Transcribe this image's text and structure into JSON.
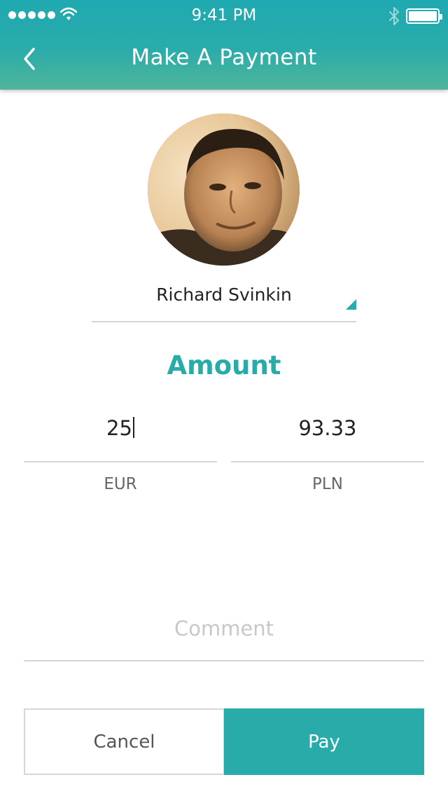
{
  "status_bar": {
    "time": "9:41 PM",
    "signal_bars": 5,
    "icons": [
      "signal-dots",
      "wifi-icon",
      "bluetooth-icon",
      "battery-icon"
    ]
  },
  "nav": {
    "back_icon": "chevron-left-icon",
    "title": "Make A Payment"
  },
  "recipient": {
    "name": "Richard Svinkin",
    "dropdown_icon": "triangle-dropdown-icon"
  },
  "amount": {
    "heading": "Amount",
    "source_value": "25",
    "source_currency": "EUR",
    "target_value": "93.33",
    "target_currency": "PLN"
  },
  "comment": {
    "placeholder": "Comment"
  },
  "actions": {
    "cancel_label": "Cancel",
    "pay_label": "Pay"
  },
  "colors": {
    "accent": "#29aca9",
    "header_top": "#1fa9b0",
    "header_bottom": "#4fb59a",
    "divider": "#d6d6d6"
  }
}
